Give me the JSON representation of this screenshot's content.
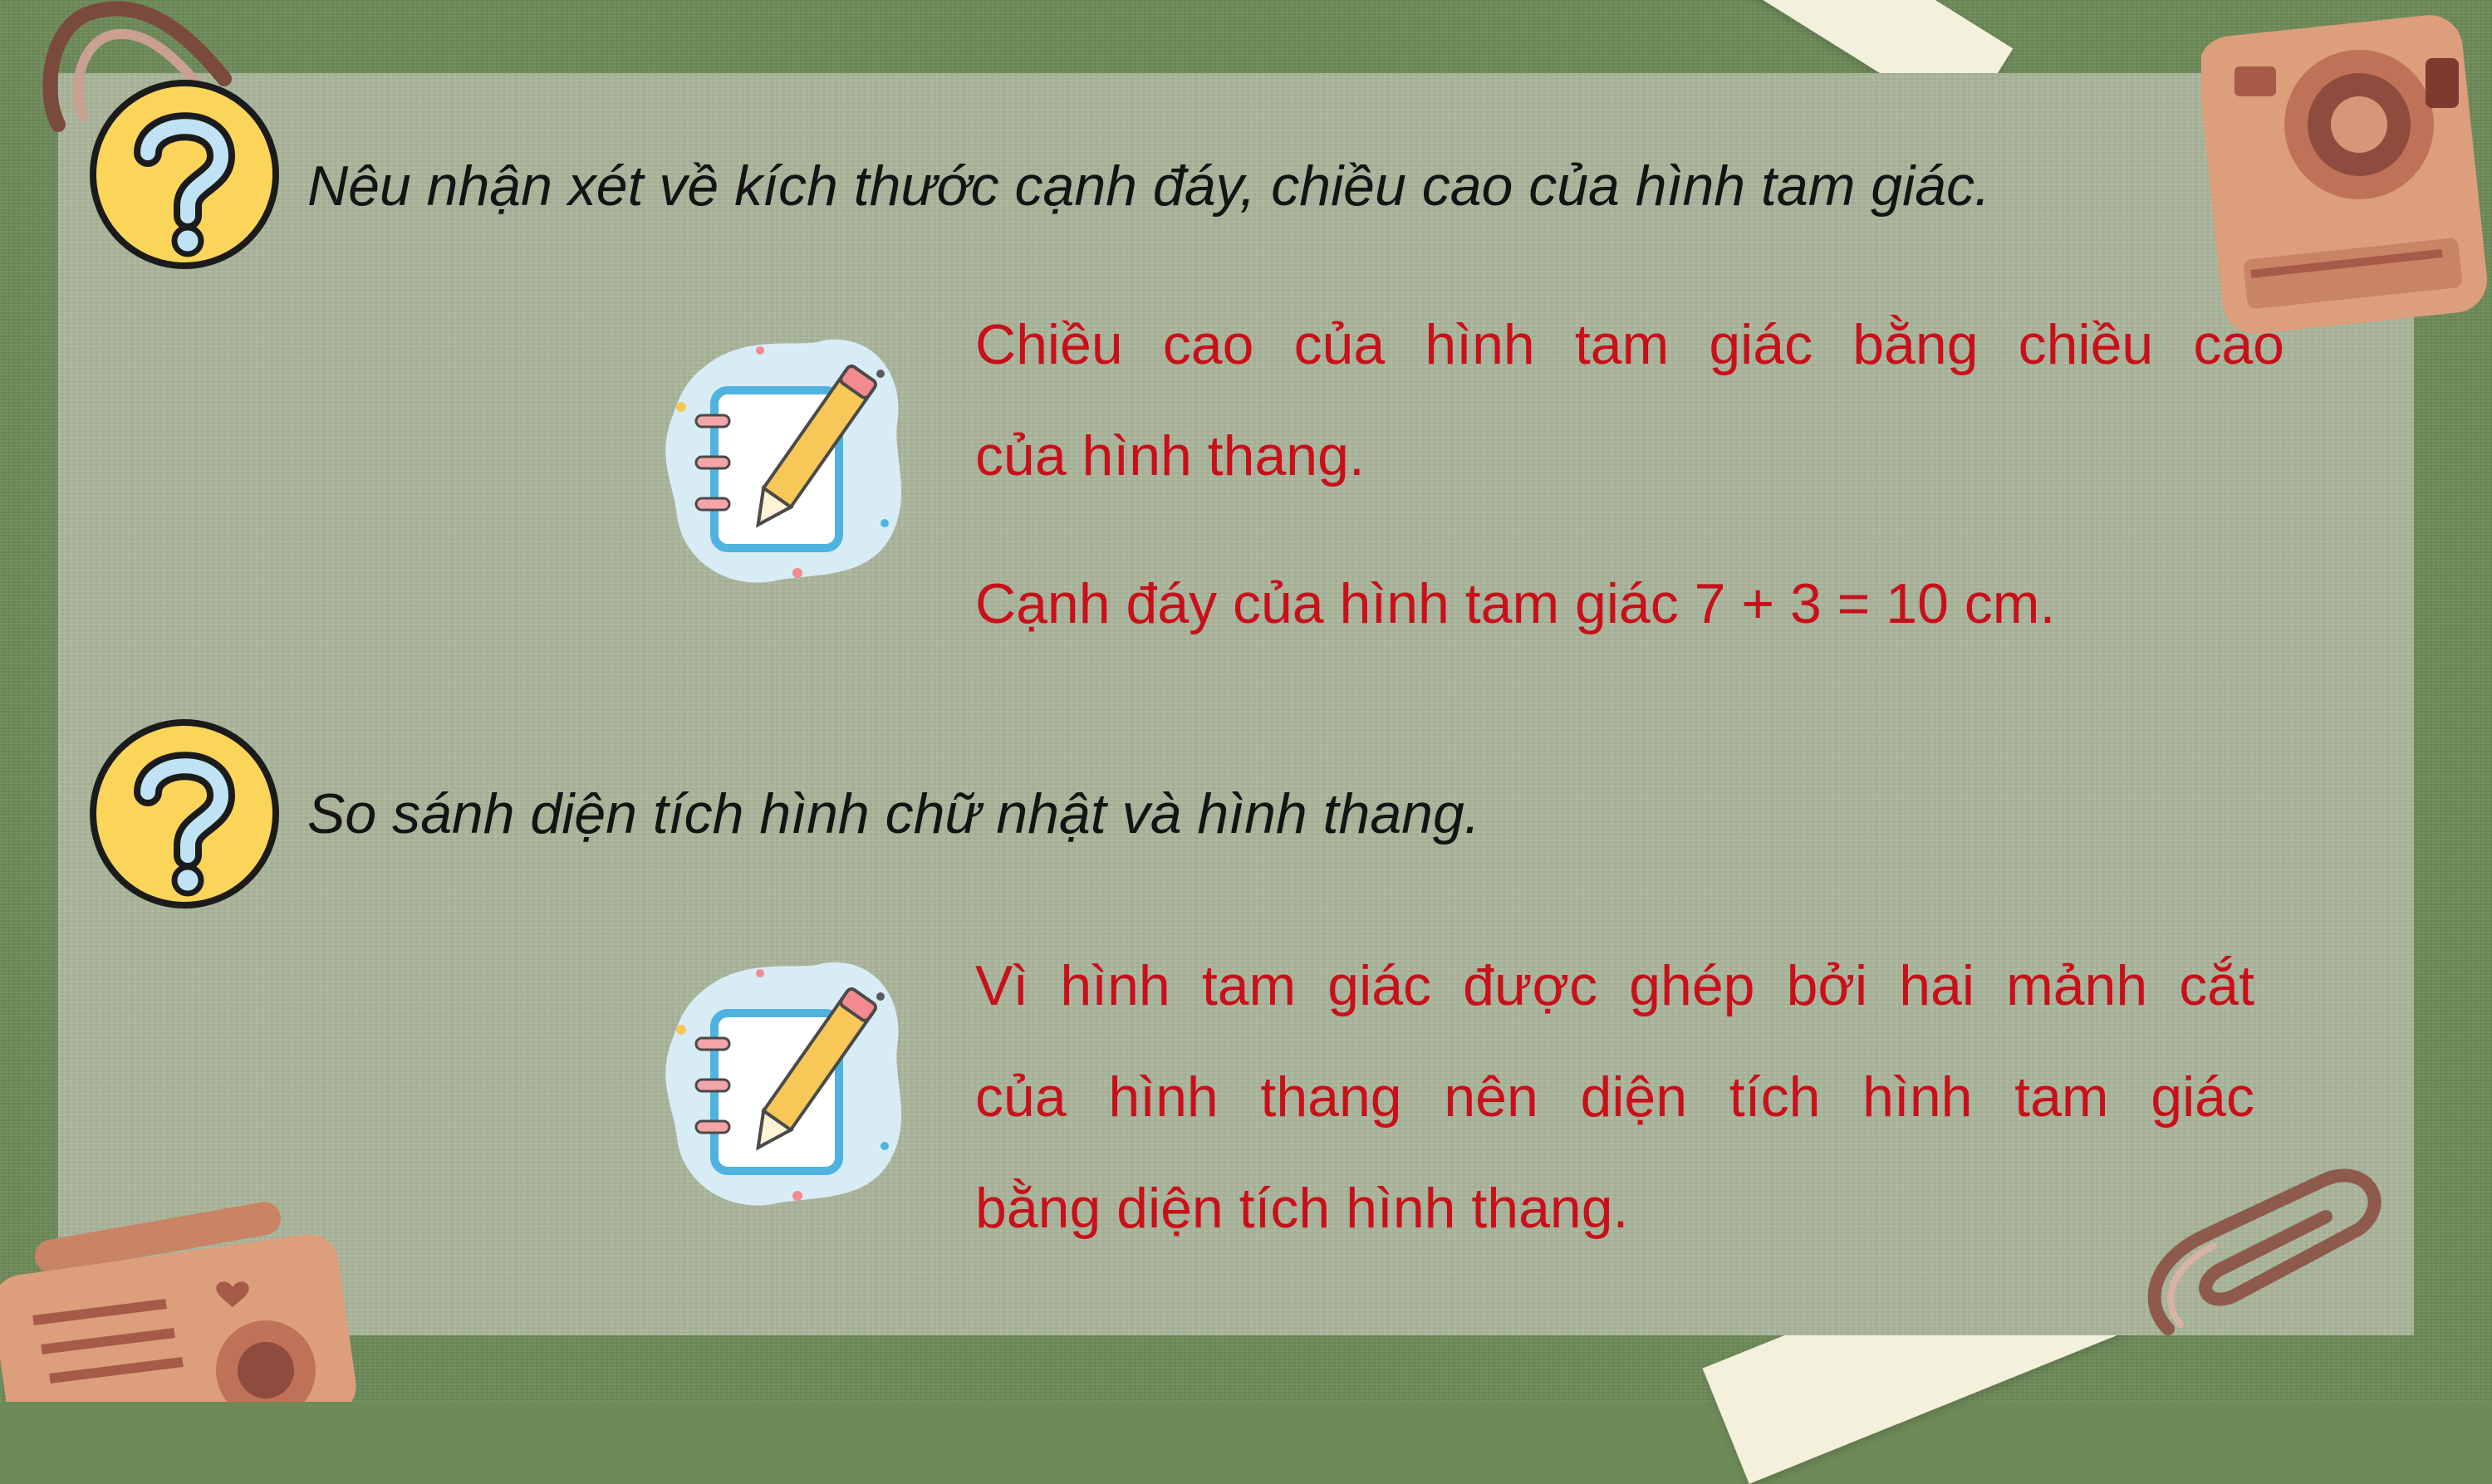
{
  "questions": [
    {
      "text": "Nêu nhận xét về kích thước cạnh đáy, chiều cao của hình tam giác.",
      "answers": [
        [
          "Chiều cao của hình tam giác bằng chiều cao",
          "của hình thang."
        ],
        [
          "Cạnh đáy của hình tam giác  7 + 3 = 10 cm."
        ]
      ]
    },
    {
      "text": "So sánh diện tích hình chữ nhật và hình thang.",
      "answers": [
        [
          "Vì hình tam giác được ghép bởi hai mảnh cắt",
          "của hình thang nên diện tích hình tam giác",
          "bằng diện tích hình thang."
        ]
      ]
    }
  ],
  "icons": [
    "question-mark-icon",
    "notebook-pencil-icon",
    "paperclip-icon",
    "camera-icon",
    "radio-icon"
  ],
  "colors": {
    "background": "#6e8a58",
    "panel": "#a9b49a",
    "question_text": "#141414",
    "answer_text": "#c8101a",
    "icon_yellow": "#fbd55a"
  }
}
